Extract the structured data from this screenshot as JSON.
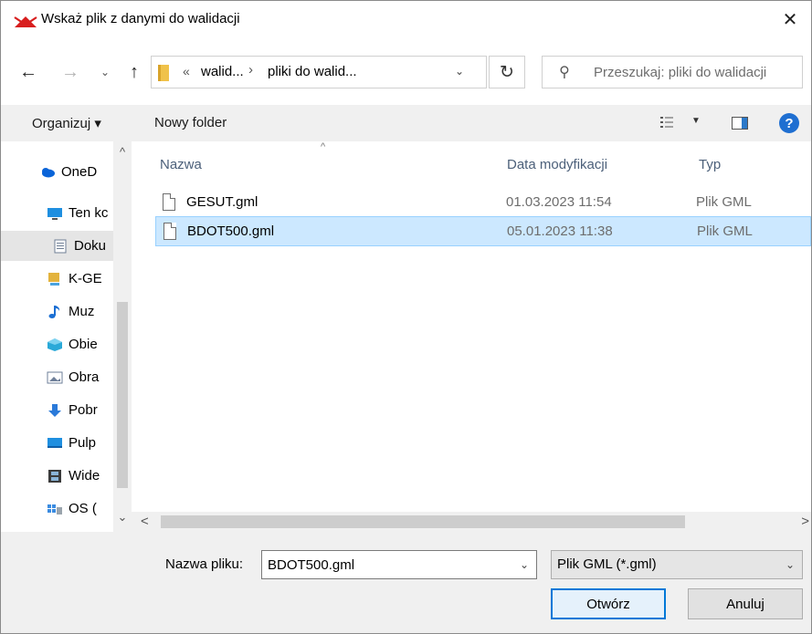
{
  "window": {
    "title": "Wskaż plik z danymi do walidacji",
    "close_symbol": "✕",
    "app_icon": "red-envelope-icon"
  },
  "navigation": {
    "back_symbol": "←",
    "forward_symbol": "→",
    "recent_symbol": "⌄",
    "up_symbol": "↑",
    "address": {
      "prefix": "«",
      "crumbs": [
        "walid...",
        "pliki do walid..."
      ],
      "separator": "›",
      "dropdown_symbol": "⌄"
    },
    "refresh_symbol": "↻",
    "search": {
      "placeholder": "Przeszukaj: pliki do walidacji",
      "icon_symbol": "⚲"
    }
  },
  "command_bar": {
    "organize_label": "Organizuj ▾",
    "new_folder_label": "Nowy folder",
    "view_dropdown_symbol": "▼",
    "help_symbol": "?"
  },
  "nav_pane": {
    "items": [
      {
        "label": "OneD",
        "icon": "onedrive-cloud-icon",
        "color": "#0a64d8"
      },
      {
        "label": "Ten kc",
        "icon": "this-pc-icon",
        "color": "#1f8fe0"
      },
      {
        "label": "Doku",
        "icon": "documents-icon",
        "color": "#6f7f95"
      },
      {
        "label": "K-GE",
        "icon": "network-drive-icon",
        "color": "#e3b33d"
      },
      {
        "label": "Muz",
        "icon": "music-icon",
        "color": "#1b6fd3"
      },
      {
        "label": "Obie",
        "icon": "3d-objects-icon",
        "color": "#2aa9d8"
      },
      {
        "label": "Obra",
        "icon": "pictures-icon",
        "color": "#6e7f99"
      },
      {
        "label": "Pobr",
        "icon": "downloads-icon",
        "color": "#2a7ad9"
      },
      {
        "label": "Pulp",
        "icon": "desktop-icon",
        "color": "#1f8fe0"
      },
      {
        "label": "Wide",
        "icon": "videos-icon",
        "color": "#3b3b3b"
      },
      {
        "label": "OS (",
        "icon": "os-drive-icon",
        "color": "#3a8be0"
      }
    ],
    "scroll_up_symbol": "^",
    "scroll_down_symbol": "⌄"
  },
  "file_list": {
    "columns": [
      "Nazwa",
      "Data modyfikacji",
      "Typ"
    ],
    "sort_symbol": "^",
    "files": [
      {
        "name": "GESUT.gml",
        "date": "01.03.2023 11:54",
        "type": "Plik GML",
        "selected": false
      },
      {
        "name": "BDOT500.gml",
        "date": "05.01.2023 11:38",
        "type": "Plik GML",
        "selected": true
      }
    ],
    "hscroll_left_symbol": "<",
    "hscroll_right_symbol": ">"
  },
  "footer": {
    "filename_label": "Nazwa pliku:",
    "filename_value": "BDOT500.gml",
    "filename_dd_symbol": "⌄",
    "filter_value": "Plik GML (*.gml)",
    "filter_dd_symbol": "⌄",
    "open_label": "Otwórz",
    "cancel_label": "Anuluj"
  },
  "colors": {
    "selection_bg": "#cce8ff",
    "selection_border": "#99d1ff",
    "accent": "#0078d7"
  }
}
